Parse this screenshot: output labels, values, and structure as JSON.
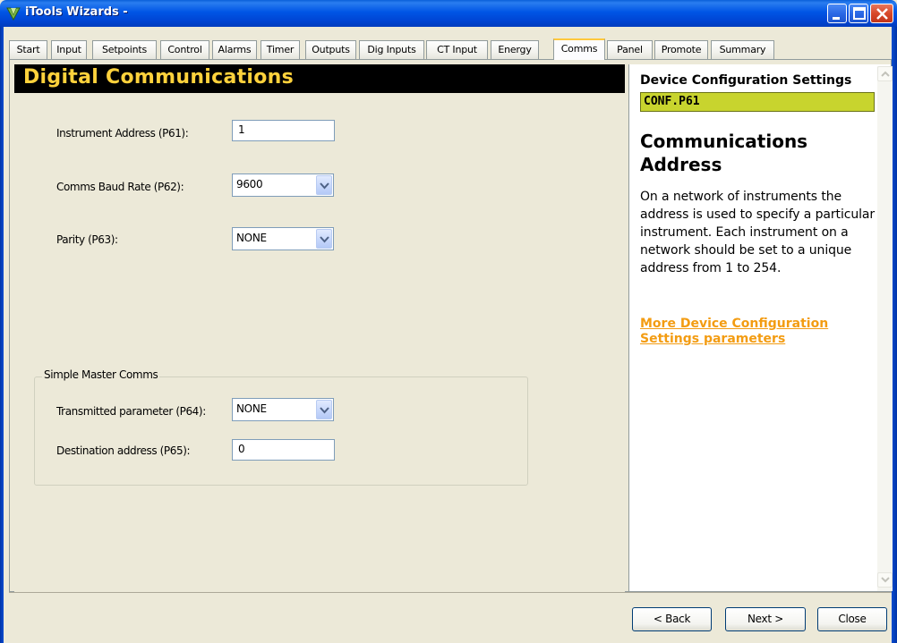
{
  "window": {
    "title": "iTools Wizards -",
    "buttons": [
      "minimize-icon",
      "maximize-icon",
      "close-icon"
    ]
  },
  "tabs": [
    {
      "label": "Start"
    },
    {
      "label": "Input"
    },
    {
      "label": "Setpoints"
    },
    {
      "label": "Control"
    },
    {
      "label": "Alarms"
    },
    {
      "label": "Timer"
    },
    {
      "label": "Outputs"
    },
    {
      "label": "Dig Inputs"
    },
    {
      "label": "CT Input"
    },
    {
      "label": "Energy"
    },
    {
      "label": "Comms",
      "active": true
    },
    {
      "label": "Panel"
    },
    {
      "label": "Promote"
    },
    {
      "label": "Summary"
    }
  ],
  "page": {
    "heading": "Digital Communications",
    "fields": {
      "address": {
        "label": "Instrument Address (P61):",
        "value": "1"
      },
      "baud": {
        "label": "Comms Baud Rate (P62):",
        "value": "9600"
      },
      "parity": {
        "label": "Parity (P63):",
        "value": "NONE"
      }
    },
    "group": {
      "legend": "Simple Master Comms",
      "transmitted": {
        "label": "Transmitted parameter (P64):",
        "value": "NONE"
      },
      "destination": {
        "label": "Destination address (P65):",
        "value": "0"
      }
    }
  },
  "help": {
    "heading": "Device Configuration Settings",
    "code": "CONF.P61",
    "title": "Communications Address",
    "body": "On a network of instruments the address is used to specify a particular instrument. Each instrument on a network should be set to a unique address from 1 to 254.",
    "link": "More Device Configuration Settings parameters",
    "link_color": "#f39c12",
    "code_bg": "#c8d42e"
  },
  "footer": {
    "back_label": "< Back",
    "next_label": "Next >",
    "close_label": "Close"
  },
  "colors": {
    "heading_text": "#ffd23c",
    "heading_bg": "#000000",
    "titlebar": "#0055e5"
  }
}
